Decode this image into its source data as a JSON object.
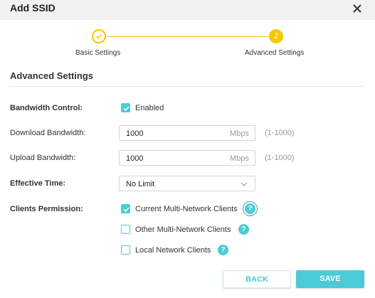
{
  "dialog": {
    "title": "Add SSID",
    "close_icon": "close-icon"
  },
  "stepper": {
    "steps": [
      {
        "label": "Basic Settings",
        "state": "done"
      },
      {
        "label": "Advanced Settings",
        "state": "active",
        "number": "2"
      }
    ],
    "accent": "#f7c700"
  },
  "section": {
    "title": "Advanced Settings"
  },
  "form": {
    "bandwidth_control": {
      "label": "Bandwidth Control:",
      "option": "Enabled",
      "checked": true
    },
    "download": {
      "label": "Download Bandwidth:",
      "value": "1000",
      "unit": "Mbps",
      "range": "(1-1000)"
    },
    "upload": {
      "label": "Upload Bandwidth:",
      "value": "1000",
      "unit": "Mbps",
      "range": "(1-1000)"
    },
    "effective_time": {
      "label": "Effective Time:",
      "value": "No Limit"
    },
    "clients_permission": {
      "label": "Clients Permission:",
      "options": [
        {
          "label": "Current Multi-Network Clients",
          "checked": true
        },
        {
          "label": "Other Multi-Network Clients",
          "checked": false
        },
        {
          "label": "Local Network Clients",
          "checked": false
        }
      ],
      "help_glyph": "?"
    }
  },
  "buttons": {
    "back": "BACK",
    "save": "SAVE"
  },
  "colors": {
    "accent": "#4acbd6",
    "step": "#f7c700",
    "header_bg": "#f2f2f2"
  }
}
